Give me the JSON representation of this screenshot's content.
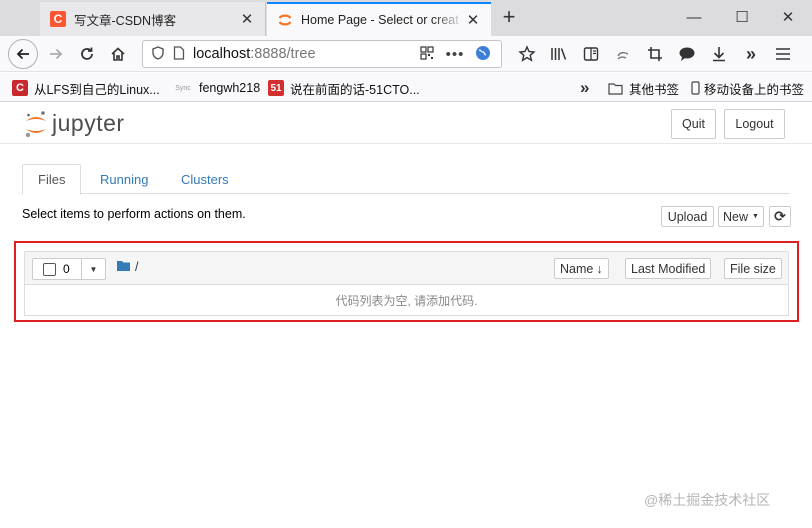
{
  "browser": {
    "tabs": [
      {
        "title": "写文章-CSDN博客",
        "active": false,
        "favicon": "C"
      },
      {
        "title": "Home Page - Select or creat",
        "active": true,
        "favicon": "jupyter-logo"
      }
    ],
    "close_glyph": "✕",
    "new_tab_glyph": "+",
    "window": {
      "minimize": "—",
      "maximize": "☐",
      "close": "✕"
    },
    "url": {
      "host": "localhost",
      "rest": ":8888/tree"
    },
    "nav_icons": [
      "back-arrow-icon",
      "forward-arrow-icon",
      "reload-icon",
      "home-icon",
      "shield-icon",
      "page-icon"
    ],
    "toolbar_icons": [
      "qr-code-icon",
      "more-dots-icon",
      "globe-icon",
      "reading-list-icon",
      "library-icon",
      "sidebar-icon",
      "screenshot-icon",
      "crop-icon",
      "chat-icon",
      "download-icon",
      "overflow-icon",
      "menu-icon"
    ],
    "bookmarks": [
      {
        "label": "从LFS到自己的Linux...",
        "icon": "C"
      },
      {
        "label": "fengwh218",
        "icon": "Sync"
      },
      {
        "label": "说在前面的话-51CTO...",
        "icon": "51"
      }
    ],
    "bookmarks_more": "»",
    "other_bookmarks": "其他书签",
    "mobile_bookmarks": "移动设备上的书签"
  },
  "jupyter": {
    "logo_text": "jupyter",
    "quit_label": "Quit",
    "logout_label": "Logout",
    "tabs": [
      {
        "label": "Files",
        "active": true
      },
      {
        "label": "Running",
        "active": false
      },
      {
        "label": "Clusters",
        "active": false
      }
    ],
    "hint": "Select items to perform actions on them.",
    "upload_label": "Upload",
    "new_label": "New",
    "refresh_glyph": "⟳",
    "selected_count": "0",
    "breadcrumb": "/",
    "sort": {
      "name": "Name",
      "name_arrow": "↓",
      "last_modified": "Last Modified",
      "file_size": "File size"
    },
    "empty_message": "代码列表为空, 请添加代码.",
    "highlight_color": "#e02020"
  },
  "watermark": "@稀土掘金技术社区"
}
